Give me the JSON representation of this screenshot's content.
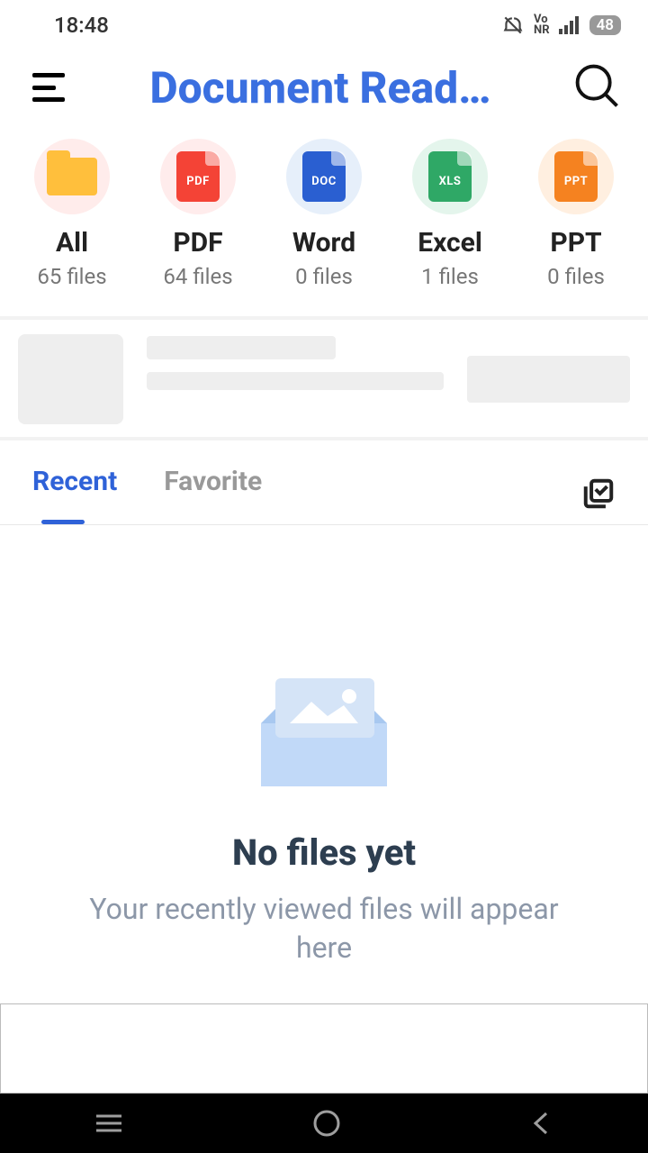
{
  "status": {
    "time": "18:48",
    "battery": "48",
    "net": "NR"
  },
  "header": {
    "title": "Document Read…"
  },
  "categories": [
    {
      "label": "All",
      "sub": "65 files",
      "bg": "#ffeceb",
      "kind": "folder"
    },
    {
      "label": "PDF",
      "sub": "64 files",
      "bg": "#ffecec",
      "kind": "file",
      "ic_bg": "#f44336",
      "ic_text": "PDF"
    },
    {
      "label": "Word",
      "sub": "0 files",
      "bg": "#e6effa",
      "kind": "file",
      "ic_bg": "#2a5fd1",
      "ic_text": "DOC"
    },
    {
      "label": "Excel",
      "sub": "1 files",
      "bg": "#e4f5ec",
      "kind": "file",
      "ic_bg": "#2fa866",
      "ic_text": "XLS"
    },
    {
      "label": "PPT",
      "sub": "0 files",
      "bg": "#ffefe0",
      "kind": "file",
      "ic_bg": "#f58220",
      "ic_text": "PPT"
    }
  ],
  "tabs": {
    "recent": "Recent",
    "favorite": "Favorite",
    "active": "recent"
  },
  "empty": {
    "title": "No files yet",
    "sub": "Your recently viewed files will appear here"
  }
}
